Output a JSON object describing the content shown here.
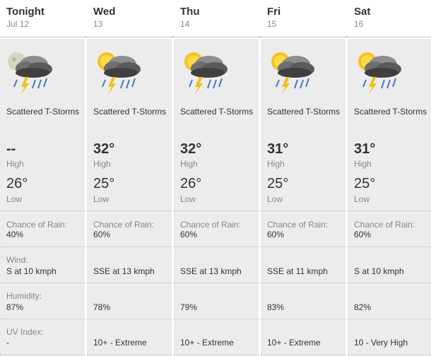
{
  "labels": {
    "high": "High",
    "low": "Low",
    "chance_of_rain": "Chance of Rain:",
    "wind": "Wind:",
    "humidity": "Humidity:",
    "uv_index": "UV Index:"
  },
  "days": [
    {
      "day": "Tonight",
      "date": "Jul 12",
      "icon": "night-thunderstorm-icon",
      "condition": "Scattered T-Storms",
      "high": "--",
      "low": "26°",
      "rain": "40%",
      "wind": "S at 10 kmph",
      "humidity": "87%",
      "uv": "-"
    },
    {
      "day": "Wed",
      "date": "13",
      "icon": "day-thunderstorm-icon",
      "condition": "Scattered T-Storms",
      "high": "32°",
      "low": "25°",
      "rain": "60%",
      "wind": "SSE at 13 kmph",
      "humidity": "78%",
      "uv": "10+ - Extreme"
    },
    {
      "day": "Thu",
      "date": "14",
      "icon": "day-thunderstorm-icon",
      "condition": "Scattered T-Storms",
      "high": "32°",
      "low": "26°",
      "rain": "60%",
      "wind": "SSE at 13 kmph",
      "humidity": "79%",
      "uv": "10+ - Extreme"
    },
    {
      "day": "Fri",
      "date": "15",
      "icon": "day-thunderstorm-icon",
      "condition": "Scattered T-Storms",
      "high": "31°",
      "low": "25°",
      "rain": "60%",
      "wind": "SSE at 11 kmph",
      "humidity": "83%",
      "uv": "10+ - Extreme"
    },
    {
      "day": "Sat",
      "date": "16",
      "icon": "day-thunderstorm-icon",
      "condition": "Scattered T-Storms",
      "high": "31°",
      "low": "25°",
      "rain": "60%",
      "wind": "S at 10 kmph",
      "humidity": "82%",
      "uv": "10 - Very High"
    }
  ]
}
